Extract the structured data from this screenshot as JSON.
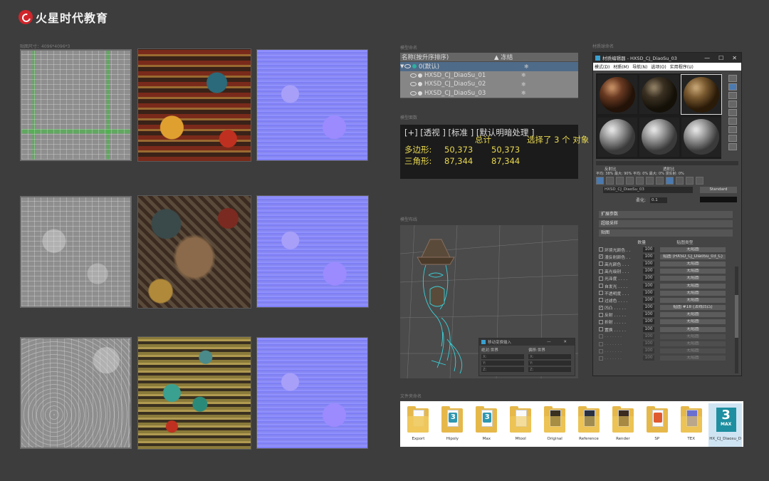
{
  "brand": {
    "name": "火星时代教育",
    "color": "#d0262b"
  },
  "texture_caption": "贴图尺寸：4096*4096*3",
  "sections": {
    "naming": "模型命名",
    "facecount": "模型面数",
    "layout": "模型布线",
    "folders": "文件夹命名",
    "material": "材质球命名"
  },
  "explorer": {
    "col_name": "名称(按升序排序)",
    "col_freeze": "▲ 冻结",
    "layer": "0(默认)",
    "objects": [
      "HXSD_CJ_DiaoSu_01",
      "HXSD_CJ_DiaoSu_02",
      "HXSD_CJ_DiaoSu_03"
    ],
    "freeze_icon": "❄"
  },
  "stats": {
    "header": "[+] [透视 ] [标准 ] [默认明暗处理 ]",
    "total_label": "总计",
    "selected_label": "选择了 3 个 对象",
    "poly_label": "多边形:",
    "poly_total": "50,373",
    "poly_selected": "50,373",
    "tri_label": "三角形:",
    "tri_total": "87,344",
    "tri_selected": "87,344"
  },
  "snap_dialog": {
    "title": "移动变换输入",
    "left_title": "绝对:世界",
    "right_title": "偏移:世界",
    "fields": [
      "X:",
      "Y:",
      "Z:"
    ]
  },
  "folders": [
    {
      "name": "Export",
      "badge": ""
    },
    {
      "name": "Hipoly",
      "badge": "3"
    },
    {
      "name": "Max",
      "badge": "3"
    },
    {
      "name": "Mtool",
      "badge": ""
    },
    {
      "name": "Original",
      "badge": ""
    },
    {
      "name": "Reference",
      "badge": ""
    },
    {
      "name": "Render",
      "badge": ""
    },
    {
      "name": "SP",
      "badge": ""
    },
    {
      "name": "TEX",
      "badge": ""
    },
    {
      "name": "HX_CJ_Diaosu_D",
      "badge": "3",
      "max_label": "MAX"
    }
  ],
  "material_editor": {
    "title": "材质编辑器 - HXSD_CJ_DiaoSu_03",
    "window_buttons": [
      "—",
      "☐",
      "✕"
    ],
    "menu": [
      "模式(D)",
      "材质(M)",
      "导航(N)",
      "选项(O)",
      "实用程序(U)"
    ],
    "reflect_label": "反射比",
    "transmit_label": "透射比",
    "avg_line": "平均:  38%  最大:  90%  平均:   0% 最大:   0%  漫反射:  0%",
    "mat_name": "HXSD_CJ_DiaoSu_03",
    "mat_type": "Standard",
    "soften_label": "柔化:",
    "soften_value": "0.1",
    "rollouts": [
      "扩展参数",
      "超级采样",
      "贴图"
    ],
    "maps_header": {
      "amount": "数量",
      "type": "贴图类型"
    },
    "map_rows": [
      {
        "name": "环境光颜色 . .",
        "amount": "100",
        "map": "无贴图",
        "checked": false,
        "dim": false
      },
      {
        "name": "漫反射颜色 . .",
        "amount": "100",
        "map": "贴图 (HXSD_CJ_DiaoSu_03_C)",
        "checked": true,
        "dim": false
      },
      {
        "name": "高光颜色 . . .",
        "amount": "100",
        "map": "无贴图",
        "checked": false,
        "dim": false
      },
      {
        "name": "高光级别 . . .",
        "amount": "100",
        "map": "无贴图",
        "checked": false,
        "dim": false
      },
      {
        "name": "光泽度 . . . .",
        "amount": "100",
        "map": "无贴图",
        "checked": false,
        "dim": false
      },
      {
        "name": "自发光 . . . .",
        "amount": "100",
        "map": "无贴图",
        "checked": false,
        "dim": false
      },
      {
        "name": "不透明度 . . .",
        "amount": "100",
        "map": "无贴图",
        "checked": false,
        "dim": false
      },
      {
        "name": "过滤色 . . . .",
        "amount": "100",
        "map": "无贴图",
        "checked": false,
        "dim": false
      },
      {
        "name": "凹凸 . . . . .",
        "amount": "100",
        "map": "贴图 #18 (法线凹凸)",
        "checked": true,
        "dim": false
      },
      {
        "name": "反射 . . . . .",
        "amount": "100",
        "map": "无贴图",
        "checked": false,
        "dim": false
      },
      {
        "name": "折射 . . . . .",
        "amount": "100",
        "map": "无贴图",
        "checked": false,
        "dim": false
      },
      {
        "name": "置换 . . . . .",
        "amount": "100",
        "map": "无贴图",
        "checked": false,
        "dim": false
      },
      {
        "name": ". . . . . . .",
        "amount": "100",
        "map": "无贴图",
        "checked": false,
        "dim": true
      },
      {
        "name": ". . . . . . .",
        "amount": "100",
        "map": "无贴图",
        "checked": false,
        "dim": true
      },
      {
        "name": ". . . . . . .",
        "amount": "100",
        "map": "无贴图",
        "checked": false,
        "dim": true
      },
      {
        "name": ". . . . . . .",
        "amount": "100",
        "map": "无贴图",
        "checked": false,
        "dim": true
      }
    ]
  }
}
